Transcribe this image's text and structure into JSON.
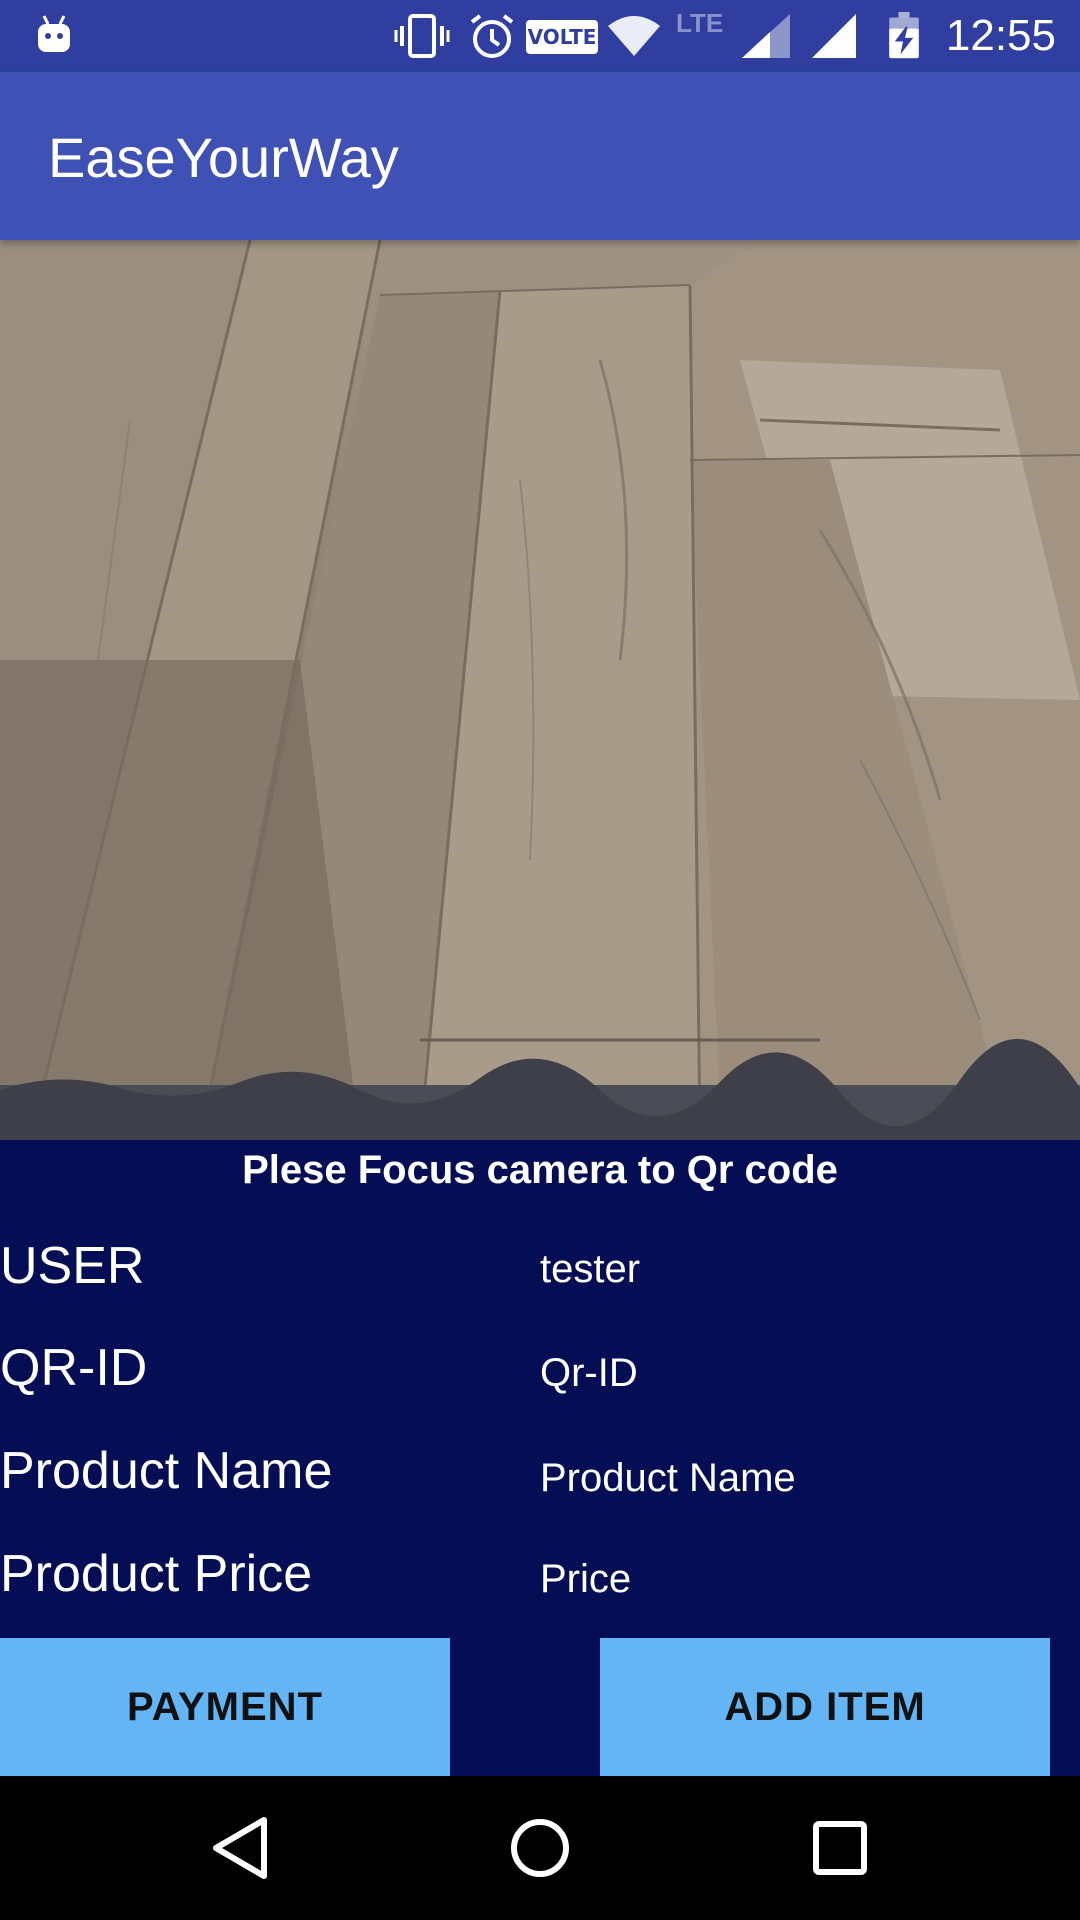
{
  "status_bar": {
    "time": "12:55",
    "volte_label": "VOLTE",
    "lte_label": "LTE",
    "icons": [
      "android-notification-icon",
      "vibrate-icon",
      "alarm-icon",
      "volte-icon",
      "wifi-icon",
      "lte-icon",
      "signal-icon",
      "signal-icon",
      "battery-charging-icon"
    ]
  },
  "app_bar": {
    "title": "EaseYourWay"
  },
  "scanner": {
    "instruction": "Plese Focus camera to Qr code"
  },
  "details": {
    "user": {
      "label": "USER",
      "value": "tester"
    },
    "qr_id": {
      "label": "QR-ID",
      "value": "Qr-ID"
    },
    "product_name": {
      "label": "Product Name",
      "value": "Product Name"
    },
    "product_price": {
      "label": "Product Price",
      "value": "Price"
    }
  },
  "actions": {
    "payment_label": "PAYMENT",
    "add_item_label": "ADD ITEM"
  },
  "nav": {
    "icons": [
      "back-icon",
      "home-icon",
      "recents-icon"
    ]
  },
  "colors": {
    "status_bar": "#303F9F",
    "app_bar": "#3F51B5",
    "panel": "#050E55",
    "button": "#64B5F6"
  }
}
